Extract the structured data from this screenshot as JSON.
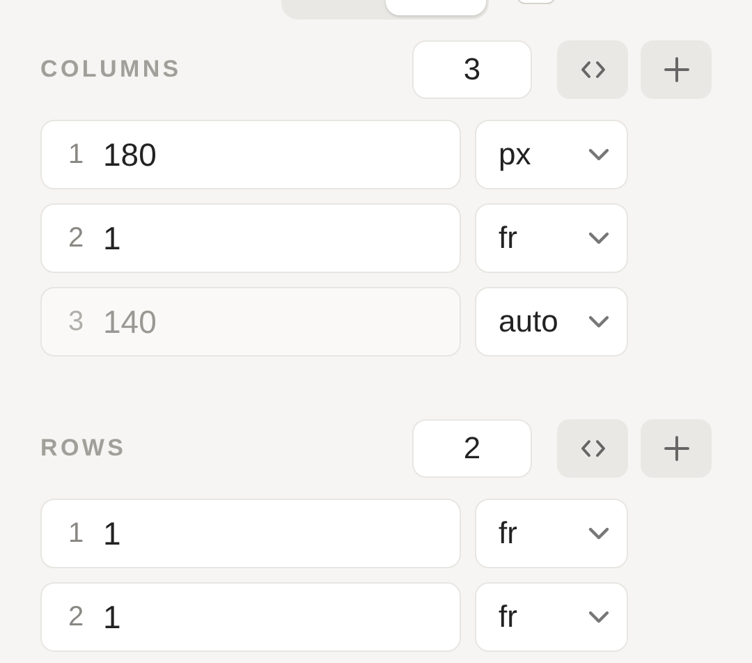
{
  "display_toggle": {
    "segments": [
      {
        "selected": false
      },
      {
        "selected": true
      }
    ]
  },
  "display_checkbox": {
    "checked": false
  },
  "sections": [
    {
      "title": "COLUMNS",
      "count": "3",
      "tracks": [
        {
          "index": "1",
          "value": "180",
          "unit": "px",
          "disabled": false
        },
        {
          "index": "2",
          "value": "1",
          "unit": "fr",
          "disabled": false
        },
        {
          "index": "3",
          "value": "140",
          "unit": "auto",
          "disabled": true
        }
      ]
    },
    {
      "title": "ROWS",
      "count": "2",
      "tracks": [
        {
          "index": "1",
          "value": "1",
          "unit": "fr",
          "disabled": false
        },
        {
          "index": "2",
          "value": "1",
          "unit": "fr",
          "disabled": false
        }
      ]
    }
  ]
}
